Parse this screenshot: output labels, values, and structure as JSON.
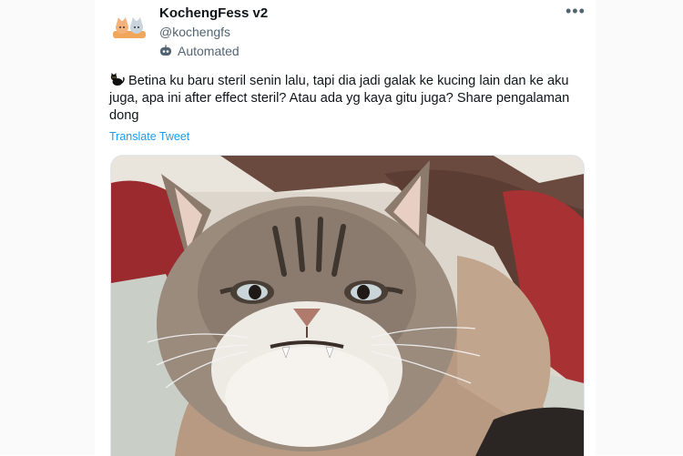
{
  "tweet": {
    "display_name": "KochengFess v2",
    "handle": "@kochengfs",
    "automated_label": "Automated",
    "body_text": "Betina ku baru steril senin lalu, tapi dia jadi galak ke kucing lain dan ke aku juga, apa ini after effect steril? Atau ada yg kaya gitu juga? Share pengalaman dong",
    "translate_label": "Translate Tweet",
    "more_label": "•••"
  },
  "icons": {
    "avatar": "cat-logo-icon",
    "automated": "robot-icon",
    "emoji": "black-cat-icon",
    "more": "more-options-icon"
  },
  "colors": {
    "link": "#1d9bf0",
    "secondary_text": "#536471",
    "primary_text": "#0f1419"
  }
}
